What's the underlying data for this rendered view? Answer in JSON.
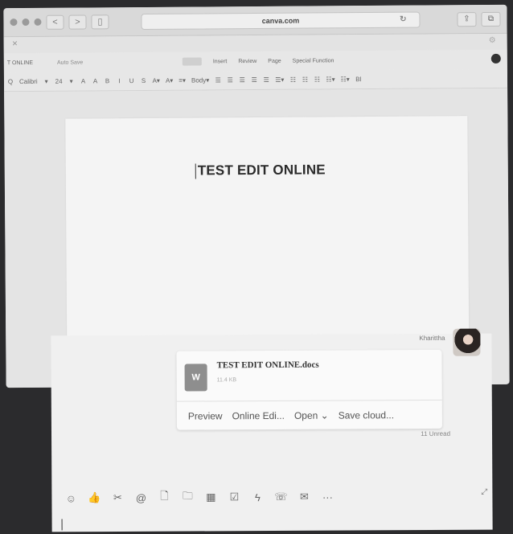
{
  "browser": {
    "url": "canva.com",
    "nav_back": "<",
    "nav_forward": ">",
    "sidebar_glyph": "▯",
    "reload_glyph": "↻",
    "share_glyph": "⇪",
    "tabs_glyph": "⧉",
    "close_glyph": "✕",
    "gear_glyph": "⚙"
  },
  "editor": {
    "doc_name": "T ONLINE",
    "autosave": "Auto Save",
    "menu": [
      "",
      "Insert",
      "Review",
      "Page",
      "Special Function"
    ],
    "format_tools": [
      "Q",
      "Calibri",
      "▾",
      "24",
      "▾",
      "A",
      "A",
      "B",
      "I",
      "U",
      "S",
      "A▾",
      "A▾",
      "≡▾",
      "Body▾",
      "☰",
      "☰",
      "☰",
      "☰",
      "☰",
      "☰▾",
      "☷",
      "☷",
      "☷",
      "☷▾",
      "☷▾",
      "Bl"
    ],
    "heading": "TEST EDIT ONLINE"
  },
  "chat": {
    "sender": "Kharittha",
    "file": {
      "icon_letter": "W",
      "name": "TEST EDIT ONLINE.docs",
      "size": "11.4 KB",
      "actions": [
        "Preview",
        "Online Edi...",
        "Open ⌄",
        "Save cloud..."
      ]
    },
    "unread": "11 Unread",
    "toolbar_icons": [
      {
        "name": "emoji-icon",
        "glyph": "☺"
      },
      {
        "name": "thumbs-up-icon",
        "glyph": "👍"
      },
      {
        "name": "scissors-icon",
        "glyph": "✂"
      },
      {
        "name": "mention-icon",
        "glyph": "@"
      },
      {
        "name": "file-icon",
        "glyph": "🗋"
      },
      {
        "name": "folder-icon",
        "glyph": "🗀"
      },
      {
        "name": "calendar-icon",
        "glyph": "▦"
      },
      {
        "name": "checklist-icon",
        "glyph": "☑"
      },
      {
        "name": "lightning-icon",
        "glyph": "ϟ"
      },
      {
        "name": "phone-icon",
        "glyph": "☏"
      },
      {
        "name": "mail-icon",
        "glyph": "✉"
      },
      {
        "name": "more-icon",
        "glyph": "···"
      }
    ],
    "expand_glyph": "⤢"
  }
}
